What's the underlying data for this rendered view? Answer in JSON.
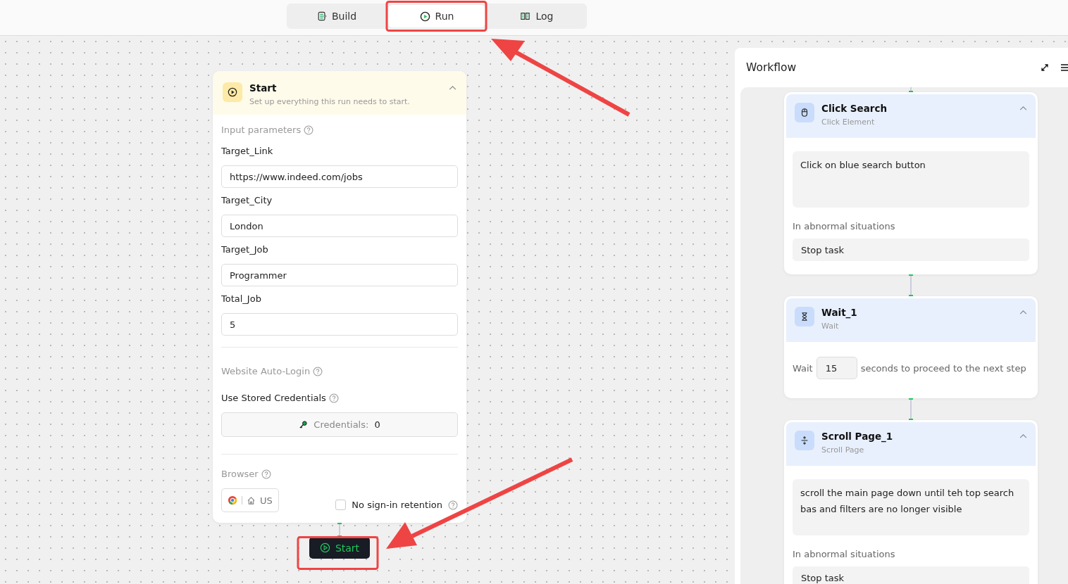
{
  "tabs": [
    {
      "label": "Build",
      "selected": false
    },
    {
      "label": "Run",
      "selected": true
    },
    {
      "label": "Log",
      "selected": false
    }
  ],
  "start_card": {
    "title": "Start",
    "subtitle": "Set up everything this run needs to start.",
    "input_section": "Input parameters",
    "params": [
      {
        "label": "Target_Link",
        "value": "https://www.indeed.com/jobs"
      },
      {
        "label": "Target_City",
        "value": "London"
      },
      {
        "label": "Target_Job",
        "value": "Programmer"
      },
      {
        "label": "Total_Job",
        "value": "5"
      }
    ],
    "auto_login_section": "Website Auto-Login",
    "stored_credentials_label": "Use Stored Credentials",
    "credentials_label": "Credentials:",
    "credentials_count": "0",
    "browser_section": "Browser",
    "browser_region": "US",
    "no_sign_in": {
      "label": "No sign-in retention",
      "checked": false
    }
  },
  "start_button": "Start",
  "workflow": {
    "title": "Workflow",
    "steps": [
      {
        "kind": "click",
        "title": "Click Search",
        "subtitle": "Click Element",
        "description": "Click on blue search button",
        "abnormal_label": "In abnormal situations",
        "abnormal_action": "Stop task"
      },
      {
        "kind": "wait",
        "title": "Wait_1",
        "subtitle": "Wait",
        "wait_prefix": "Wait",
        "wait_value": "15",
        "wait_suffix": "seconds to proceed to the next step"
      },
      {
        "kind": "scroll",
        "title": "Scroll Page_1",
        "subtitle": "Scroll Page",
        "description": "scroll the main page down until teh top search bas and filters are no longer visible",
        "abnormal_label": "In abnormal situations",
        "abnormal_action": "Stop task"
      }
    ]
  }
}
